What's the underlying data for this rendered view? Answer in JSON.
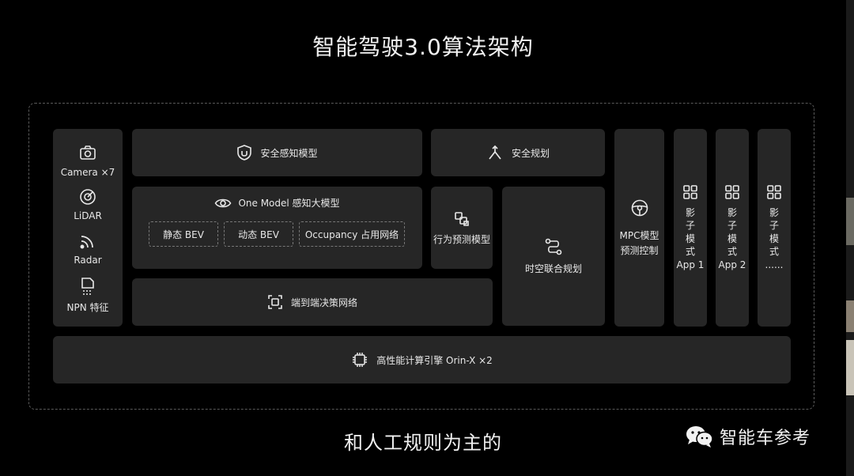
{
  "title": "智能驾驶3.0算法架构",
  "sensors": [
    {
      "label": "Camera ×7",
      "icon": "camera-icon"
    },
    {
      "label": "LiDAR",
      "icon": "lidar-icon"
    },
    {
      "label": "Radar",
      "icon": "radar-icon"
    },
    {
      "label": "NPN 特征",
      "icon": "npn-icon"
    }
  ],
  "perception": {
    "safety_model": "安全感知模型",
    "one_model": "One Model 感知大模型",
    "static_bev": "静态 BEV",
    "dynamic_bev": "动态 BEV",
    "occupancy": "Occupancy 占用网络"
  },
  "planning": {
    "safety_planning": "安全规划",
    "behavior_prediction": "行为预测模型",
    "spatiotemporal_planning": "时空联合规划",
    "mpc_line1": "MPC模型",
    "mpc_line2": "预测控制"
  },
  "end_to_end": "端到端决策网络",
  "shadow_apps": [
    {
      "chars": [
        "影",
        "子",
        "模",
        "式"
      ],
      "label": "App 1"
    },
    {
      "chars": [
        "影",
        "子",
        "模",
        "式"
      ],
      "label": "App 2"
    },
    {
      "chars": [
        "影",
        "子",
        "模",
        "式"
      ],
      "label": "......"
    }
  ],
  "compute": "高性能计算引擎 Orin-X ×2",
  "caption": "和人工规则为主的",
  "watermark": "智能车参考",
  "colors": {
    "background": "#000000",
    "box": "#262626",
    "text": "#e8e8e8"
  }
}
